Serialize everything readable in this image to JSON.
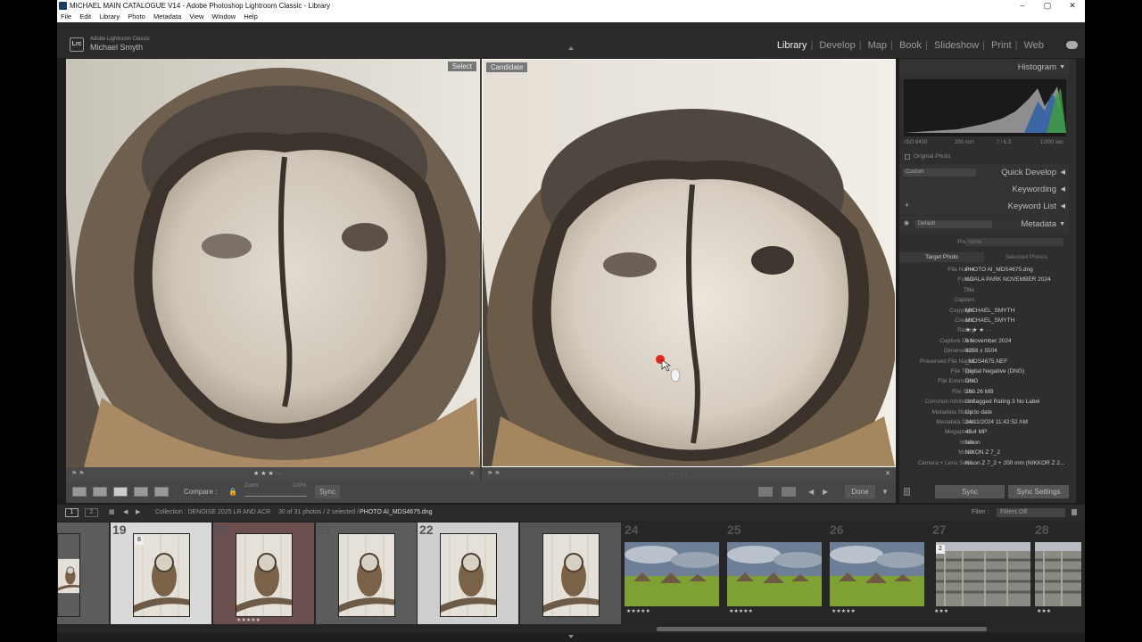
{
  "window": {
    "title": "MICHAEL MAIN CATALOGUE V14 - Adobe Photoshop Lightroom Classic - Library",
    "minimize": "–",
    "maximize": "▢",
    "close": "✕"
  },
  "menu": [
    "File",
    "Edit",
    "Library",
    "Photo",
    "Metadata",
    "View",
    "Window",
    "Help"
  ],
  "identity": {
    "badge": "Lrc",
    "product": "Adobe Lightroom Classic",
    "user": "Michael Smyth"
  },
  "modules": [
    "Library",
    "Develop",
    "Map",
    "Book",
    "Slideshow",
    "Print",
    "Web"
  ],
  "active_module": "Library",
  "compare": {
    "select_label": "Select",
    "candidate_label": "Candidate",
    "left_stars": "★ ★ ★ · ·",
    "right_stars": "· · · · ·"
  },
  "toolbar": {
    "compare_label": "Compare :",
    "zoom_label": "Zoom",
    "zoom_value": "100%",
    "sync_label": "Sync",
    "done_label": "Done"
  },
  "histogram": {
    "title": "Histogram",
    "iso": "ISO 6400",
    "focal": "200 mm",
    "aperture": "f / 6.3",
    "shutter": "1/200 sec",
    "original_photo": "Original Photo"
  },
  "panels": {
    "quick_develop": "Quick Develop",
    "quick_develop_preset": "Custom",
    "keywording": "Keywording",
    "keyword_list": "Keyword List",
    "metadata": "Metadata",
    "metadata_preset": "Default"
  },
  "metadata": {
    "preset_label": "Preset",
    "preset_value": "None",
    "tab_target": "Target Photo",
    "tab_selected": "Selected Photos",
    "rows": [
      {
        "k": "File Name",
        "v": "PHOTO AI_MDS4675.dng"
      },
      {
        "k": "Folder",
        "v": "KOALA PARK NOVEMBER 2024"
      },
      {
        "k": "Title",
        "v": ""
      },
      {
        "k": "Caption",
        "v": ""
      },
      {
        "k": "Copyright",
        "v": "MICHAEL_SMYTH"
      },
      {
        "k": "Creator",
        "v": "MICHAEL_SMYTH"
      },
      {
        "k": "Rating",
        "v": "★ ★ ★ · ·"
      },
      {
        "k": "Capture Date",
        "v": "6 November 2024"
      },
      {
        "k": "Dimensions",
        "v": "8256 x 5504"
      },
      {
        "k": "Preserved File Name",
        "v": "_MDS4675.NEF"
      },
      {
        "k": "File Type",
        "v": "Digital Negative (DNG)"
      },
      {
        "k": "File Extension",
        "v": "DNG"
      },
      {
        "k": "File Size",
        "v": "260.26 MB"
      },
      {
        "k": "Common Attributes",
        "v": "Unflagged     Rating 3     No Label"
      },
      {
        "k": "Metadata Status",
        "v": "Up to date"
      },
      {
        "k": "Metadata Date",
        "v": "24/11/2024 11:42:52 AM"
      },
      {
        "k": "Megapixels",
        "v": "45.4 MP"
      },
      {
        "k": "Make",
        "v": "Nikon"
      },
      {
        "k": "Model",
        "v": "NIKON Z 7_2"
      },
      {
        "k": "Camera + Lens Sett...",
        "v": "Nikon Z 7_2 + 200 mm (NIKKOR Z 2..."
      }
    ],
    "sync_label": "Sync",
    "sync_settings_label": "Sync Settings"
  },
  "filmstrip_bar": {
    "page1": "1",
    "page2": "2",
    "collection": "Collection : DENOISE 2025 LR AND ACR",
    "count": "30 of 31 photos / 2 selected /",
    "filename": "PHOTO AI_MDS4675.dng",
    "filter_label": "Filter :",
    "filter_value": "Filters Off"
  },
  "filmstrip": [
    {
      "num": "",
      "type": "owl",
      "stars": ""
    },
    {
      "num": "19",
      "type": "owl",
      "stars": "",
      "badge": "8"
    },
    {
      "num": "20",
      "type": "owl",
      "stars": "★★★★★"
    },
    {
      "num": "21",
      "type": "owl",
      "stars": ""
    },
    {
      "num": "22",
      "type": "owl",
      "stars": "★★★"
    },
    {
      "num": "23",
      "type": "owl",
      "stars": ""
    },
    {
      "num": "24",
      "type": "land",
      "stars": "★★★★★"
    },
    {
      "num": "25",
      "type": "land",
      "stars": "★★★★★"
    },
    {
      "num": "26",
      "type": "land",
      "stars": "★★★★★"
    },
    {
      "num": "27",
      "type": "city",
      "stars": "★★★",
      "badge": "2"
    },
    {
      "num": "28",
      "type": "city",
      "stars": "★★★"
    }
  ],
  "colors": {
    "accent_active": "#eeeeee",
    "panel": "#2e2e2e",
    "owl_face": "#d6cdc2",
    "owl_brown": "#6e5a44"
  }
}
